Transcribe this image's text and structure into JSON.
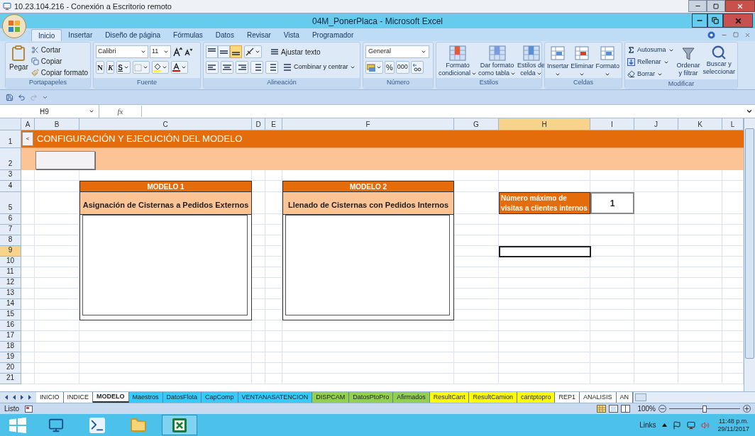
{
  "remote_window": {
    "title": "10.23.104.216 - Conexión a Escritorio remoto"
  },
  "window": {
    "title": "04M_PonerPlaca - Microsoft Excel"
  },
  "ribbon_tabs": [
    {
      "label": "Inicio",
      "selected": true
    },
    {
      "label": "Insertar",
      "selected": false
    },
    {
      "label": "Diseño de página",
      "selected": false
    },
    {
      "label": "Fórmulas",
      "selected": false
    },
    {
      "label": "Datos",
      "selected": false
    },
    {
      "label": "Revisar",
      "selected": false
    },
    {
      "label": "Vista",
      "selected": false
    },
    {
      "label": "Programador",
      "selected": false
    }
  ],
  "clipboard": {
    "label": "Portapapeles",
    "paste": "Pegar",
    "cut": "Cortar",
    "copy": "Copiar",
    "format_painter": "Copiar formato"
  },
  "font": {
    "label": "Fuente",
    "font_name": "Calibri",
    "font_size": "11",
    "bold": "N",
    "italic": "K",
    "underline": "S"
  },
  "alignment": {
    "label": "Alineación",
    "vertical": [
      {
        "selected": false
      },
      {
        "selected": false
      },
      {
        "selected": true
      }
    ],
    "wrap": "Ajustar texto",
    "merge": "Combinar y centrar"
  },
  "number": {
    "label": "Número",
    "format": "General",
    "percent": "%",
    "thousands": "000"
  },
  "styles": {
    "label": "Estilos",
    "buttons": [
      {
        "lines": [
          "Formato",
          "condicional"
        ]
      },
      {
        "lines": [
          "Dar formato",
          "como tabla"
        ]
      },
      {
        "lines": [
          "Estilos de",
          "celda"
        ]
      }
    ]
  },
  "cells": {
    "label": "Celdas",
    "buttons": [
      "Insertar",
      "Eliminar",
      "Formato"
    ]
  },
  "editing": {
    "label": "Modificar",
    "autosum": "Autosuma",
    "fill": "Rellenar",
    "clear": "Borrar",
    "sort": [
      "Ordenar",
      "y filtrar"
    ],
    "find": [
      "Buscar y",
      "seleccionar"
    ]
  },
  "name_box": "H9",
  "formula_bar": {
    "function_label": "fx"
  },
  "columns": [
    {
      "label": "A",
      "selected": false
    },
    {
      "label": "B",
      "selected": false
    },
    {
      "label": "C",
      "selected": false
    },
    {
      "label": "D",
      "selected": false
    },
    {
      "label": "E",
      "selected": false
    },
    {
      "label": "F",
      "selected": false
    },
    {
      "label": "G",
      "selected": false
    },
    {
      "label": "H",
      "selected": true
    },
    {
      "label": "I",
      "selected": false
    },
    {
      "label": "J",
      "selected": false
    },
    {
      "label": "K",
      "selected": false
    },
    {
      "label": "L",
      "selected": false
    }
  ],
  "rows": [
    {
      "label": "1",
      "selected": false
    },
    {
      "label": "2",
      "selected": false
    },
    {
      "label": "3",
      "selected": false
    },
    {
      "label": "4",
      "selected": false
    },
    {
      "label": "5",
      "selected": false
    },
    {
      "label": "6",
      "selected": false
    },
    {
      "label": "7",
      "selected": false
    },
    {
      "label": "8",
      "selected": false
    },
    {
      "label": "9",
      "selected": true
    },
    {
      "label": "10",
      "selected": false
    },
    {
      "label": "11",
      "selected": false
    },
    {
      "label": "12",
      "selected": false
    },
    {
      "label": "13",
      "selected": false
    },
    {
      "label": "14",
      "selected": false
    },
    {
      "label": "15",
      "selected": false
    },
    {
      "label": "16",
      "selected": false
    },
    {
      "label": "17",
      "selected": false
    },
    {
      "label": "18",
      "selected": false
    },
    {
      "label": "19",
      "selected": false
    },
    {
      "label": "20",
      "selected": false
    },
    {
      "label": "21",
      "selected": false
    }
  ],
  "sheet": {
    "collapse_button": "<",
    "title": "CONFIGURACIÓN Y EJECUCIÓN DEL MODELO",
    "models": [
      {
        "header": "MODELO 1",
        "title": "Asignación de Cisternas a Pedidos Externos"
      },
      {
        "header": "MODELO 2",
        "title": "Llenado de Cisternas con Pedidos Internos"
      }
    ],
    "parameter": {
      "label": "Número máximo de visitas a clientes internos",
      "value": "1"
    }
  },
  "sheet_tabs": [
    {
      "label": "INICIO",
      "selected": false,
      "color": "#ffffff"
    },
    {
      "label": "INDICE",
      "selected": false,
      "color": "#ffffff"
    },
    {
      "label": "MODELO",
      "selected": true,
      "color": "#ffffff"
    },
    {
      "label": "Maestros",
      "selected": false,
      "color": "#33ccff"
    },
    {
      "label": "DatosFlota",
      "selected": false,
      "color": "#33ccff"
    },
    {
      "label": "CapComp",
      "selected": false,
      "color": "#33ccff"
    },
    {
      "label": "VENTANASATENCION",
      "selected": false,
      "color": "#33ccff"
    },
    {
      "label": "DISPCAM",
      "selected": false,
      "color": "#92d050"
    },
    {
      "label": "DatosPtoPro",
      "selected": false,
      "color": "#92d050"
    },
    {
      "label": "Afirmados",
      "selected": false,
      "color": "#92d050"
    },
    {
      "label": "ResultCant",
      "selected": false,
      "color": "#ffff00"
    },
    {
      "label": "ResultCamion",
      "selected": false,
      "color": "#ffff00"
    },
    {
      "label": "cantptopro",
      "selected": false,
      "color": "#ffff00"
    },
    {
      "label": "REP1",
      "selected": false,
      "color": "#ffffff"
    },
    {
      "label": "ANALISIS",
      "selected": false,
      "color": "#ffffff"
    },
    {
      "label": "AN",
      "selected": false,
      "color": "#ffffff"
    }
  ],
  "status_bar": {
    "status": "Listo",
    "zoom": {
      "reading": "100%",
      "level": 0.5
    }
  },
  "taskbar": {
    "links": "Links",
    "time": "11:48 p.m.",
    "date": "29/11/2017"
  }
}
